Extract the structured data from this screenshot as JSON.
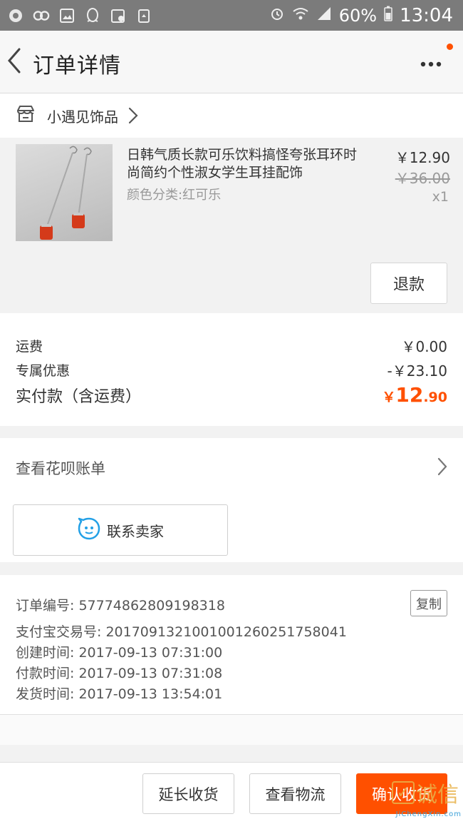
{
  "status_bar": {
    "battery": "60%",
    "time": "13:04"
  },
  "header": {
    "title": "订单详情",
    "back_icon": "chevron-left-icon",
    "more_icon": "more-icon"
  },
  "shop": {
    "name": "小遇见饰品"
  },
  "item": {
    "title": "日韩气质长款可乐饮料搞怪夸张耳环时尚简约个性淑女学生耳挂配饰",
    "sku": "颜色分类:红可乐",
    "price": "￥12.90",
    "original_price": "￥36.00",
    "quantity": "x1",
    "refund_label": "退款"
  },
  "summary": {
    "shipping_label": "运费",
    "shipping_value": "￥0.00",
    "discount_label": "专属优惠",
    "discount_value": "-￥23.10",
    "total_label": "实付款（含运费）",
    "total_currency": "￥",
    "total_int": "12",
    "total_dec": ".90"
  },
  "huabei": {
    "label": "查看花呗账单",
    "contact_label": "联系卖家"
  },
  "order_info": {
    "order_no": "订单编号: 57774862809198318",
    "alipay_no": "支付宝交易号: 2017091321001001260251758041",
    "created": "创建时间: 2017-09-13 07:31:00",
    "paid": "付款时间: 2017-09-13 07:31:08",
    "shipped": "发货时间: 2017-09-13 13:54:01",
    "copy_label": "复制"
  },
  "bottom_bar": {
    "extend_label": "延长收货",
    "logistics_label": "查看物流",
    "confirm_label": "确认收货"
  },
  "watermark": {
    "logo_text": "诚信",
    "url": "JiChengXin.com"
  },
  "colors": {
    "accent": "#ff5000",
    "status_bar": "#7b7b7b"
  }
}
